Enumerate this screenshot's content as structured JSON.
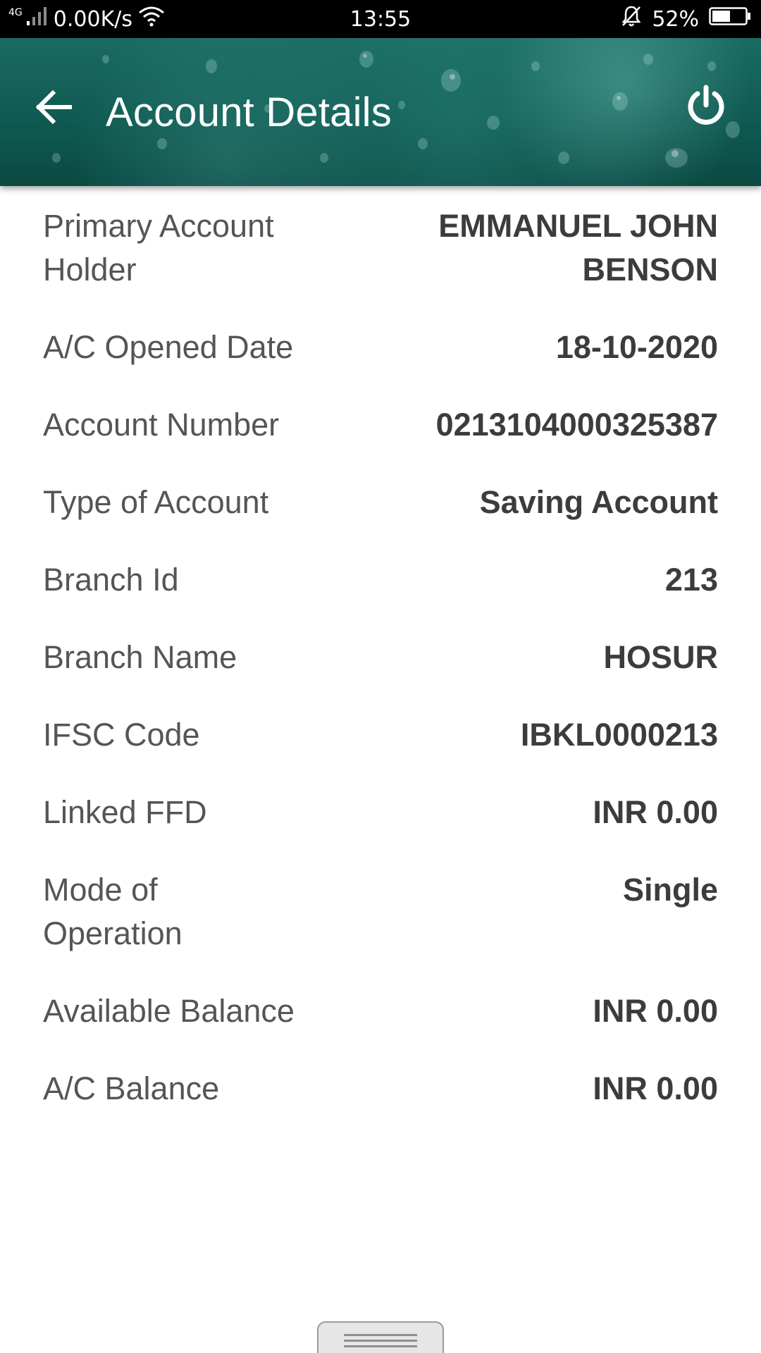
{
  "status_bar": {
    "network_type": "4G",
    "speed": "0.00K/s",
    "time": "13:55",
    "battery": "52%",
    "icons": [
      "signal-icon",
      "wifi-icon",
      "mute-bell-icon",
      "battery-icon"
    ]
  },
  "app_bar": {
    "title": "Account Details",
    "back_icon": "arrow-left-icon",
    "logout_icon": "power-icon",
    "background_color": "#0f5a52"
  },
  "details": [
    {
      "label": "Primary Account Holder",
      "value": "EMMANUEL JOHN BENSON"
    },
    {
      "label": "A/C Opened Date",
      "value": "18-10-2020"
    },
    {
      "label": "Account Number",
      "value": "0213104000325387"
    },
    {
      "label": "Type of Account",
      "value": "Saving Account"
    },
    {
      "label": "Branch Id",
      "value": "213"
    },
    {
      "label": "Branch Name",
      "value": "HOSUR"
    },
    {
      "label": "IFSC Code",
      "value": "IBKL0000213"
    },
    {
      "label": "Linked FFD",
      "value": "INR 0.00"
    },
    {
      "label": "Mode of Operation",
      "value": "Single"
    },
    {
      "label": "Available Balance",
      "value": "INR 0.00"
    },
    {
      "label": "A/C Balance",
      "value": "INR 0.00"
    }
  ],
  "bottom_handle": {
    "icon": "drag-handle-icon"
  }
}
